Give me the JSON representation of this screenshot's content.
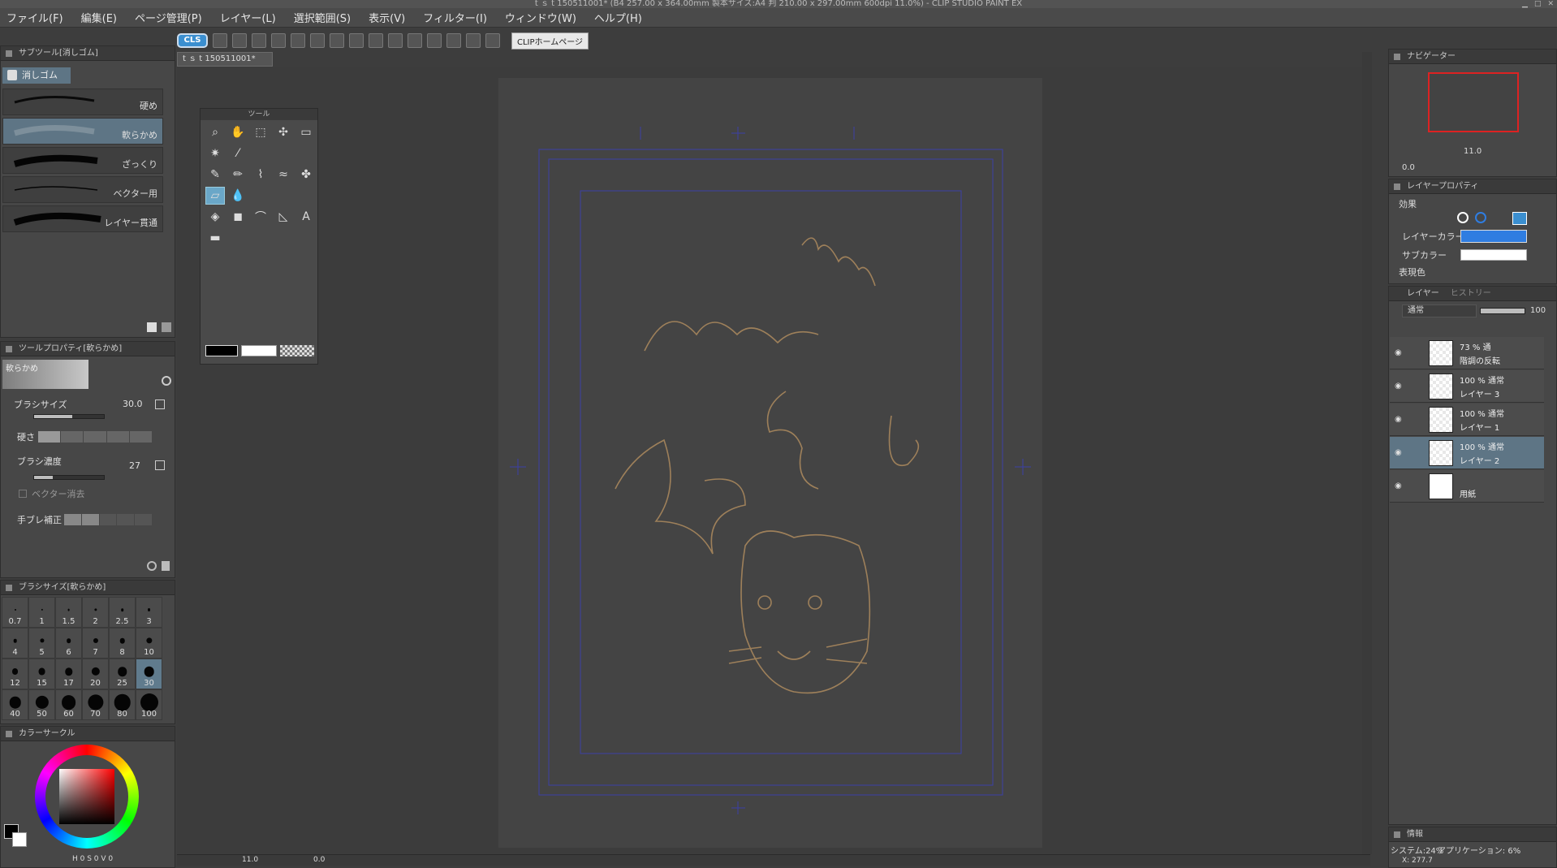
{
  "window": {
    "title": "t ｓ t 150511001* (B4 257.00 x 364.00mm 製本サイズ:A4 判 210.00 x 297.00mm 600dpi 11.0%) - CLIP STUDIO PAINT EX"
  },
  "menu": [
    "ファイル(F)",
    "編集(E)",
    "ページ管理(P)",
    "レイヤー(L)",
    "選択範囲(S)",
    "表示(V)",
    "フィルター(I)",
    "ウィンドウ(W)",
    "ヘルプ(H)"
  ],
  "command_bar": {
    "logo": "CLS",
    "home_button": "CLIPホームページ"
  },
  "document_tab": "t ｓ t 150511001*",
  "subtool_panel": {
    "title": "サブツール[消しゴム]",
    "group": "消しゴム",
    "items": [
      {
        "label": "硬め",
        "selected": false
      },
      {
        "label": "軟らかめ",
        "selected": true
      },
      {
        "label": "ざっくり",
        "selected": false
      },
      {
        "label": "ベクター用",
        "selected": false
      },
      {
        "label": "レイヤー貫通",
        "selected": false
      }
    ]
  },
  "tool_property": {
    "title": "ツールプロパティ[軟らかめ]",
    "preset": "軟らかめ",
    "brush_size_label": "ブラシサイズ",
    "brush_size_value": "30.0",
    "hardness_label": "硬さ",
    "density_label": "ブラシ濃度",
    "density_value": "27",
    "vector_erase_label": "ベクター消去",
    "stabilization_label": "手ブレ補正"
  },
  "brush_size_panel": {
    "title": "ブラシサイズ[軟らかめ]",
    "sizes": [
      "0.7",
      "1",
      "1.5",
      "2",
      "2.5",
      "3",
      "4",
      "5",
      "6",
      "7",
      "8",
      "10",
      "12",
      "15",
      "17",
      "20",
      "25",
      "30",
      "40",
      "50",
      "60",
      "70",
      "80",
      "100"
    ],
    "selected": "30"
  },
  "color_panel": {
    "title": "カラーサークル",
    "hsv_readout": "H 0 S 0 V 0"
  },
  "tool_palette": {
    "title": "ツール"
  },
  "navigator": {
    "title": "ナビゲーター",
    "zoom": "11.0",
    "rotate": "0.0"
  },
  "layer_property": {
    "title": "レイヤープロパティ",
    "effect_label": "効果",
    "layer_color_label": "レイヤーカラー",
    "sub_color_label": "サブカラー",
    "expression_label": "表現色"
  },
  "layers_panel": {
    "tab_layer": "レイヤー",
    "tab_history": "ヒストリー",
    "blend_mode": "通常",
    "opacity": "100",
    "layers": [
      {
        "top": "73 % 通",
        "name": "階調の反転",
        "selected": false
      },
      {
        "top": "100 % 通常",
        "name": "レイヤー 3",
        "selected": false
      },
      {
        "top": "100 % 通常",
        "name": "レイヤー 1",
        "selected": false
      },
      {
        "top": "100 % 通常",
        "name": "レイヤー 2",
        "selected": true
      },
      {
        "top": "",
        "name": "用紙",
        "selected": false
      }
    ]
  },
  "info_panel": {
    "title": "情報",
    "system": "システム:24%",
    "application": "アプリケーション: 6%",
    "x_readout": "X: 277.7"
  },
  "status": {
    "zoom": "11.0",
    "angle": "0.0"
  },
  "colors": {
    "layer_color": "#2f7de1",
    "sketch_stroke": "#c49a64",
    "guide_line": "#3b3fa6"
  }
}
